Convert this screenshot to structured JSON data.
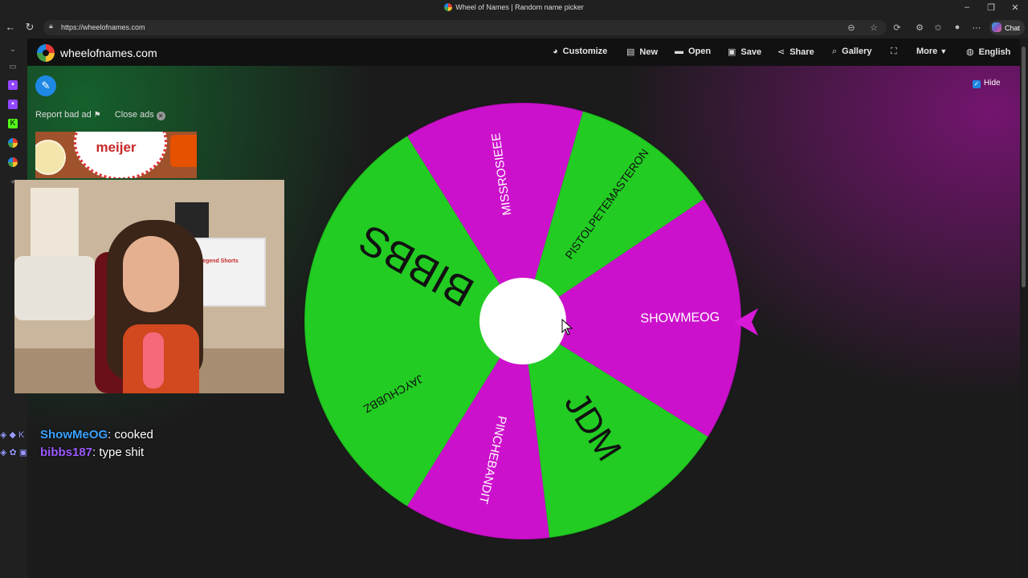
{
  "browser": {
    "window_title": "Wheel of Names | Random name picker",
    "url": "https://wheelofnames.com",
    "chat_label": "Chat"
  },
  "header": {
    "brand": "wheelofnames.com",
    "menu": [
      {
        "label": "Customize",
        "icon": "palette-icon"
      },
      {
        "label": "New",
        "icon": "file-icon"
      },
      {
        "label": "Open",
        "icon": "folder-icon"
      },
      {
        "label": "Save",
        "icon": "save-icon"
      },
      {
        "label": "Share",
        "icon": "share-icon"
      },
      {
        "label": "Gallery",
        "icon": "search-icon"
      },
      {
        "label": "",
        "icon": "fullscreen-icon"
      },
      {
        "label": "More",
        "icon": "chevron-down-icon"
      },
      {
        "label": "English",
        "icon": "globe-icon"
      }
    ]
  },
  "ads": {
    "report_label": "Report bad ad",
    "close_label": "Close ads",
    "ad_text": "meijer"
  },
  "webcam": {
    "sign_text": "Sol Legend Shorts"
  },
  "chat": [
    {
      "user": "ShowMeOG",
      "message": ": cooked"
    },
    {
      "user": "bibbs187",
      "message": ": type shit"
    }
  ],
  "options": {
    "hide_label": "Hide",
    "hide_checked": true
  },
  "wheel": {
    "colors": {
      "green": "#22cc22",
      "magenta": "#cc11cc",
      "center": "#ffffff"
    },
    "segments": [
      {
        "label": "SHOWMEOG",
        "color": "magenta"
      },
      {
        "label": "JDM",
        "color": "green"
      },
      {
        "label": "PINCHEBANDIT",
        "color": "magenta"
      },
      {
        "label": "JAYCHUBBZ",
        "color": "green"
      },
      {
        "label": "BIBBS",
        "color": "green"
      },
      {
        "label": "MISSROSIEEE",
        "color": "magenta"
      },
      {
        "label": "PISTOLPETEMASTERON",
        "color": "green"
      }
    ]
  }
}
